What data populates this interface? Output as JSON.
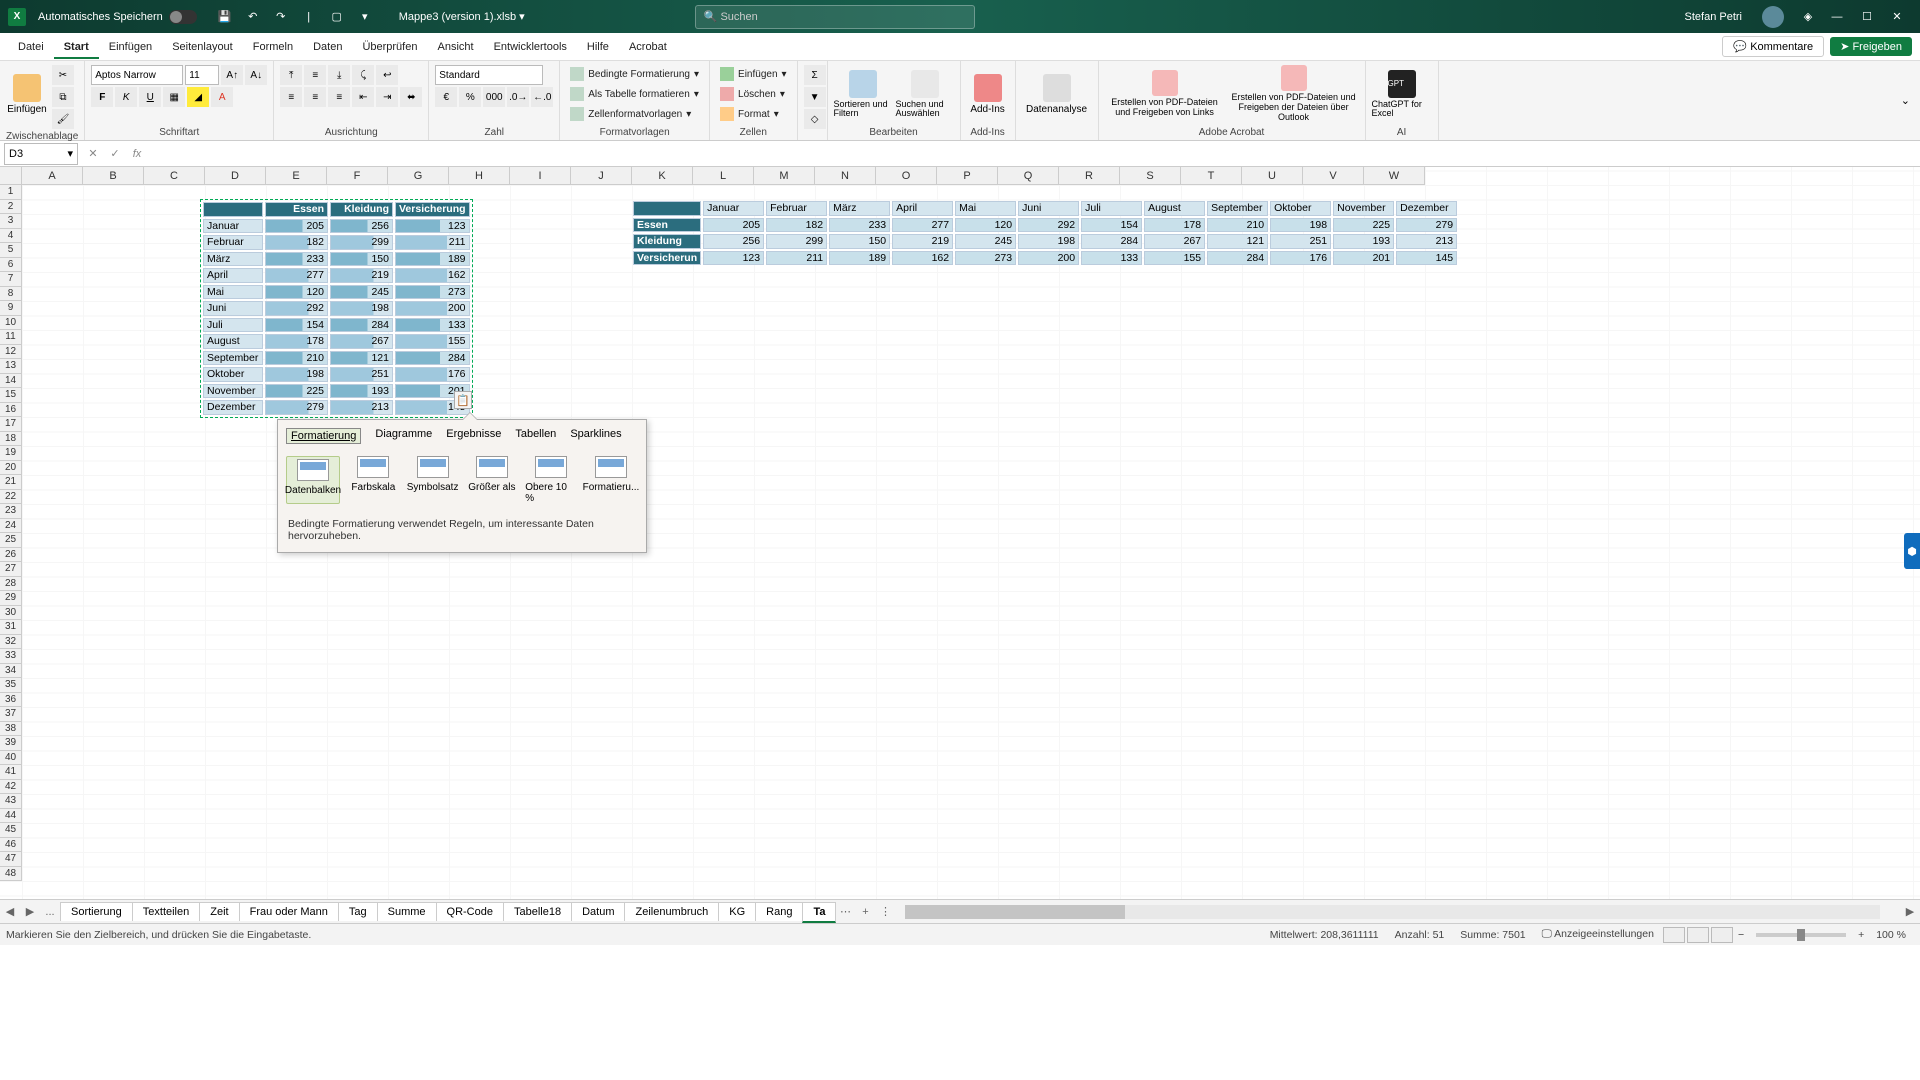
{
  "title": {
    "autosave": "Automatisches Speichern",
    "filename": "Mappe3 (version 1).xlsb ▾",
    "search_placeholder": "Suchen",
    "user": "Stefan Petri"
  },
  "menu": {
    "tabs": [
      "Datei",
      "Start",
      "Einfügen",
      "Seitenlayout",
      "Formeln",
      "Daten",
      "Überprüfen",
      "Ansicht",
      "Entwicklertools",
      "Hilfe",
      "Acrobat"
    ],
    "active": 1,
    "comments": "Kommentare",
    "share": "Freigeben"
  },
  "ribbon": {
    "clipboard": {
      "paste": "Einfügen",
      "label": "Zwischenablage"
    },
    "font": {
      "name": "Aptos Narrow",
      "size": "11",
      "label": "Schriftart"
    },
    "align": {
      "label": "Ausrichtung"
    },
    "number": {
      "format": "Standard",
      "label": "Zahl"
    },
    "styles": {
      "cond": "Bedingte Formatierung",
      "astable": "Als Tabelle formatieren",
      "cell": "Zellenformatvorlagen",
      "label": "Formatvorlagen"
    },
    "cells": {
      "ins": "Einfügen",
      "del": "Löschen",
      "fmt": "Format",
      "label": "Zellen"
    },
    "editing": {
      "sort": "Sortieren und Filtern",
      "find": "Suchen und Auswählen",
      "label": "Bearbeiten"
    },
    "addins": {
      "addins": "Add-Ins",
      "label": "Add-Ins"
    },
    "analysis": "Datenanalyse",
    "acrobat": {
      "a": "Erstellen von PDF-Dateien und Freigeben von Links",
      "b": "Erstellen von PDF-Dateien und Freigeben der Dateien über Outlook",
      "label": "Adobe Acrobat"
    },
    "gpt": {
      "btn": "ChatGPT for Excel",
      "label": "AI"
    }
  },
  "fxbar": {
    "cellref": "D3"
  },
  "columns": [
    "A",
    "B",
    "C",
    "D",
    "E",
    "F",
    "G",
    "H",
    "I",
    "J",
    "K",
    "L",
    "M",
    "N",
    "O",
    "P",
    "Q",
    "R",
    "S",
    "T",
    "U",
    "V",
    "W"
  ],
  "table1": {
    "headers": [
      "Essen",
      "Kleidung",
      "Versicherung"
    ],
    "rows": [
      {
        "label": "Januar",
        "v": [
          205,
          256,
          123
        ]
      },
      {
        "label": "Februar",
        "v": [
          182,
          299,
          211
        ]
      },
      {
        "label": "März",
        "v": [
          233,
          150,
          189
        ]
      },
      {
        "label": "April",
        "v": [
          277,
          219,
          162
        ]
      },
      {
        "label": "Mai",
        "v": [
          120,
          245,
          273
        ]
      },
      {
        "label": "Juni",
        "v": [
          292,
          198,
          200
        ]
      },
      {
        "label": "Juli",
        "v": [
          154,
          284,
          133
        ]
      },
      {
        "label": "August",
        "v": [
          178,
          267,
          155
        ]
      },
      {
        "label": "September",
        "v": [
          210,
          121,
          284
        ]
      },
      {
        "label": "Oktober",
        "v": [
          198,
          251,
          176
        ]
      },
      {
        "label": "November",
        "v": [
          225,
          193,
          201
        ]
      },
      {
        "label": "Dezember",
        "v": [
          279,
          213,
          145
        ]
      }
    ]
  },
  "table2": {
    "months": [
      "Januar",
      "Februar",
      "März",
      "April",
      "Mai",
      "Juni",
      "Juli",
      "August",
      "September",
      "Oktober",
      "November",
      "Dezember"
    ],
    "rows": [
      {
        "label": "Essen",
        "v": [
          205,
          182,
          233,
          277,
          120,
          292,
          154,
          178,
          210,
          198,
          225,
          279
        ]
      },
      {
        "label": "Kleidung",
        "v": [
          256,
          299,
          150,
          219,
          245,
          198,
          284,
          267,
          121,
          251,
          193,
          213
        ]
      },
      {
        "label": "Versicherun",
        "v": [
          123,
          211,
          189,
          162,
          273,
          200,
          133,
          155,
          284,
          176,
          201,
          145
        ]
      }
    ]
  },
  "qa": {
    "tabs": [
      "Formatierung",
      "Diagramme",
      "Ergebnisse",
      "Tabellen",
      "Sparklines"
    ],
    "items": [
      "Datenbalken",
      "Farbskala",
      "Symbolsatz",
      "Größer als",
      "Obere 10 %",
      "Formatieru..."
    ],
    "desc": "Bedingte Formatierung verwendet Regeln, um interessante Daten hervorzuheben."
  },
  "sheets": {
    "tabs": [
      "Sortierung",
      "Textteilen",
      "Zeit",
      "Frau oder Mann",
      "Tag",
      "Summe",
      "QR-Code",
      "Tabelle18",
      "Datum",
      "Zeilenumbruch",
      "KG",
      "Rang",
      "Ta"
    ],
    "more": "..."
  },
  "status": {
    "msg": "Markieren Sie den Zielbereich, und drücken Sie die Eingabetaste.",
    "mean": "Mittelwert: 208,3611111",
    "count": "Anzahl: 51",
    "sum": "Summe: 7501",
    "display": "Anzeigeeinstellungen",
    "zoom": "100 %"
  }
}
